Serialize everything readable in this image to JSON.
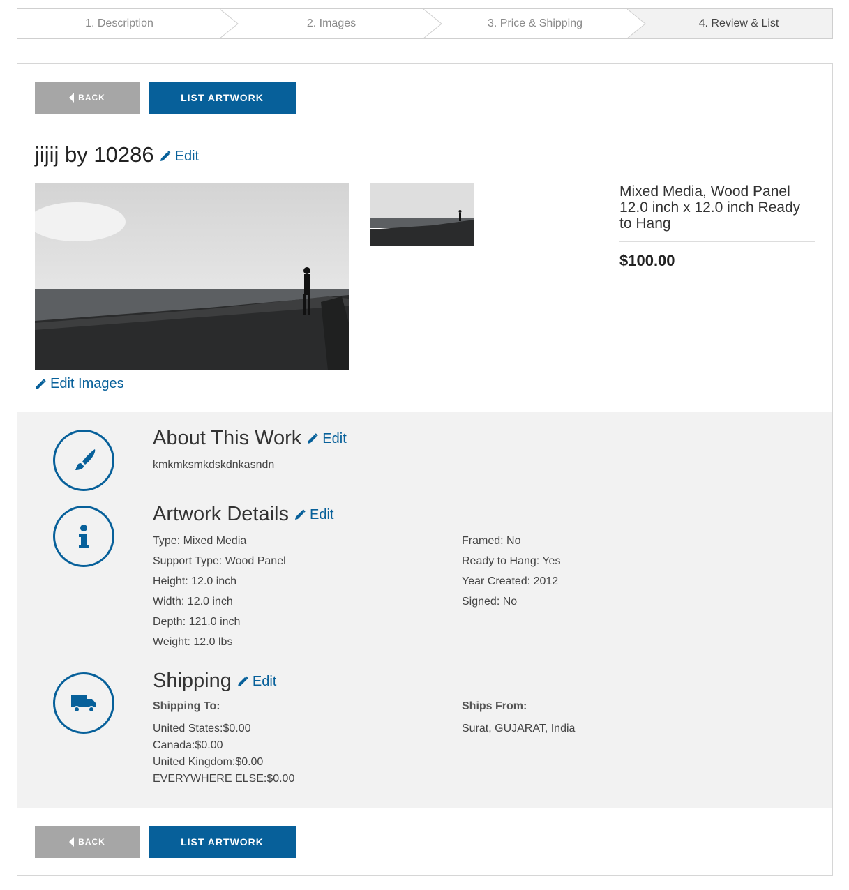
{
  "stepper": {
    "steps": [
      {
        "label": "1. Description"
      },
      {
        "label": "2. Images"
      },
      {
        "label": "3. Price & Shipping"
      },
      {
        "label": "4. Review & List"
      }
    ]
  },
  "actions": {
    "back_label": "BACK",
    "list_label": "LIST ARTWORK"
  },
  "artwork": {
    "title": "jijij by 10286",
    "edit_label": "Edit",
    "edit_images_label": "Edit Images",
    "summary": "Mixed Media, Wood Panel 12.0 inch x 12.0 inch Ready to Hang",
    "price": "$100.00"
  },
  "about": {
    "title": "About This Work",
    "edit_label": "Edit",
    "text": "kmkmksmkdskdnkasndn",
    "icon": "paintbrush-icon"
  },
  "details": {
    "title": "Artwork Details",
    "edit_label": "Edit",
    "icon": "info-icon",
    "left": [
      "Type: Mixed Media",
      "Support Type: Wood Panel",
      "Height: 12.0 inch",
      "Width: 12.0 inch",
      "Depth: 121.0 inch",
      "Weight: 12.0 lbs"
    ],
    "right": [
      "Framed: No",
      "Ready to Hang: Yes",
      "Year Created: 2012",
      "Signed: No"
    ]
  },
  "shipping": {
    "title": "Shipping",
    "edit_label": "Edit",
    "icon": "truck-icon",
    "to_label": "Shipping To:",
    "to": [
      "United States:$0.00",
      "Canada:$0.00",
      "United Kingdom:$0.00",
      "EVERYWHERE ELSE:$0.00"
    ],
    "from_label": "Ships From:",
    "from": "Surat, GUJARAT, India"
  },
  "colors": {
    "primary": "#07609a",
    "back_button": "#a6a6a6",
    "section_bg": "#f2f2f2"
  }
}
